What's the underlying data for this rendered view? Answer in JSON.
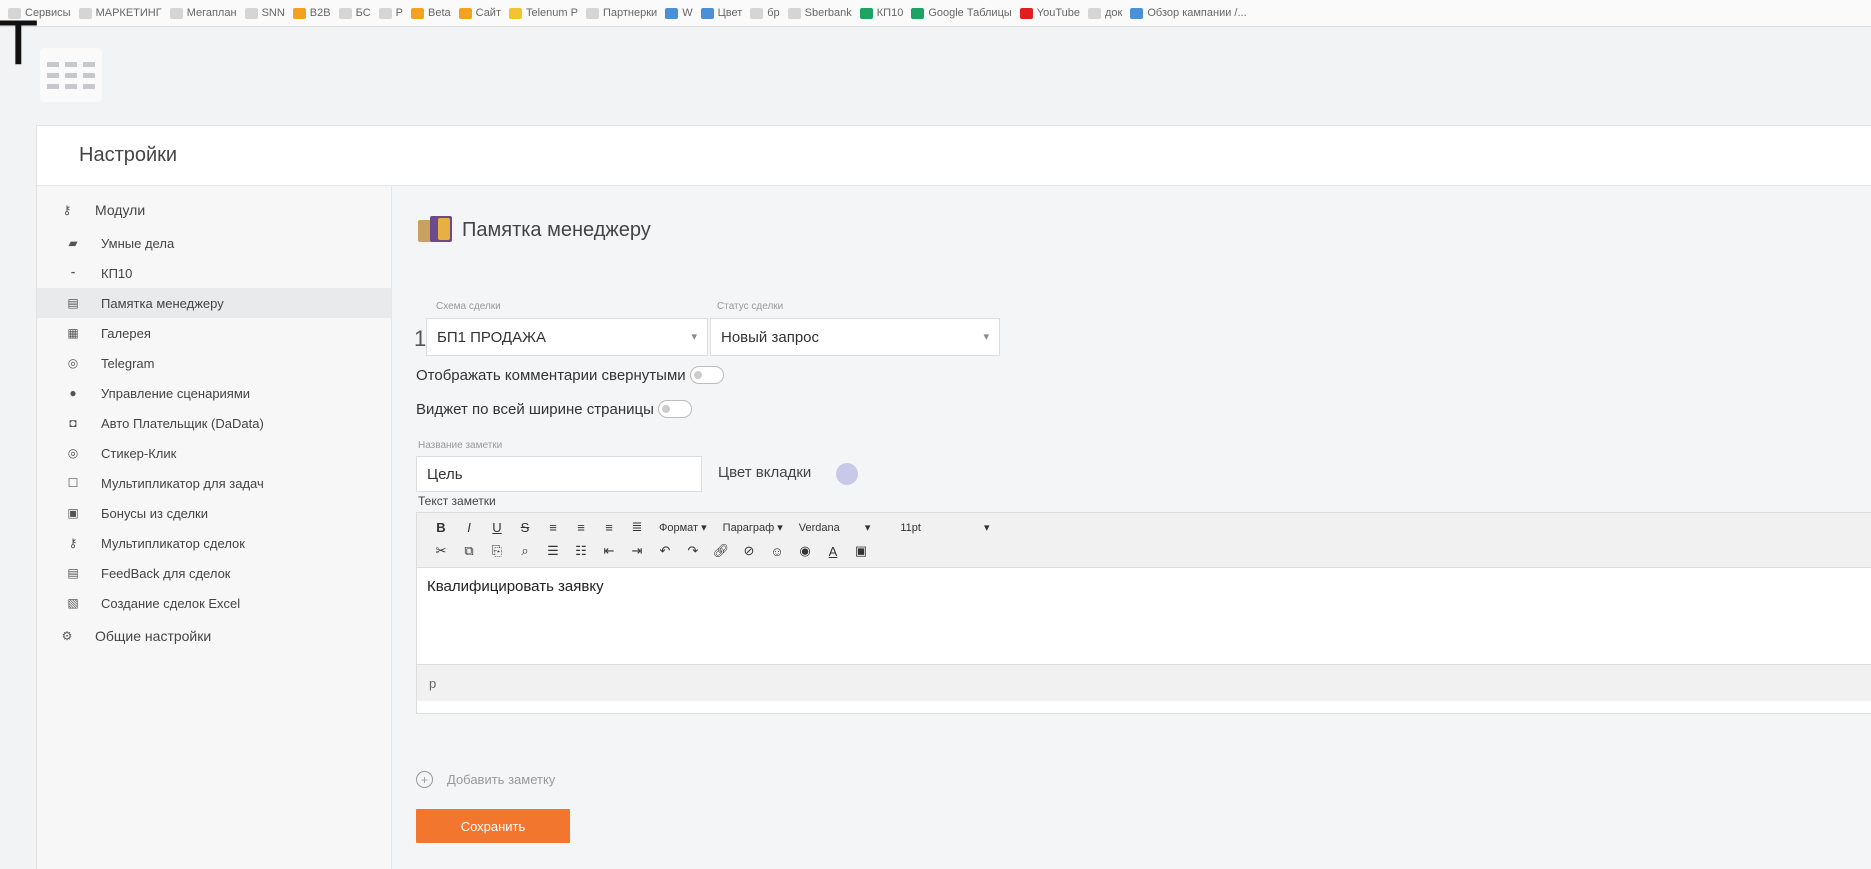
{
  "bookmarks": [
    {
      "label": "Сервисы",
      "icon": "apps-icon",
      "color": "folder"
    },
    {
      "label": "МАРКЕТИНГ",
      "icon": "folder-icon",
      "color": "folder"
    },
    {
      "label": "Мегаплан",
      "icon": "folder-icon",
      "color": "folder"
    },
    {
      "label": "SNN",
      "icon": "folder-icon",
      "color": "folder"
    },
    {
      "label": "B2B",
      "icon": "bookmark-icon",
      "color": "orange"
    },
    {
      "label": "БС",
      "icon": "folder-icon",
      "color": "folder"
    },
    {
      "label": "P",
      "icon": "folder-icon",
      "color": "folder"
    },
    {
      "label": "Beta",
      "icon": "bookmark-icon",
      "color": "orange"
    },
    {
      "label": "Сайт",
      "icon": "bookmark-icon",
      "color": "orange"
    },
    {
      "label": "Telenum P",
      "icon": "bookmark-icon",
      "color": "yellow"
    },
    {
      "label": "Партнерки",
      "icon": "folder-icon",
      "color": "folder"
    },
    {
      "label": "W",
      "icon": "bookmark-icon",
      "color": "blue"
    },
    {
      "label": "Цвет",
      "icon": "bookmark-icon",
      "color": "blue"
    },
    {
      "label": "бр",
      "icon": "folder-icon",
      "color": "folder"
    },
    {
      "label": "Sberbank",
      "icon": "page-icon",
      "color": "folder"
    },
    {
      "label": "КП10",
      "icon": "bookmark-icon",
      "color": "green"
    },
    {
      "label": "Google Таблицы",
      "icon": "sheets-icon",
      "color": "green"
    },
    {
      "label": "YouTube",
      "icon": "youtube-icon",
      "color": "red"
    },
    {
      "label": "док",
      "icon": "page-icon",
      "color": "folder"
    },
    {
      "label": "Обзор кампании /...",
      "icon": "bookmark-icon",
      "color": "blue"
    }
  ],
  "overlay_text": "T",
  "settings": {
    "title": "Настройки"
  },
  "sidebar": {
    "section_modules": "Модули",
    "items": [
      {
        "label": "Умные дела",
        "icon": "smart-tasks-icon"
      },
      {
        "label": "КП10",
        "icon": "kp10-icon"
      },
      {
        "label": "Памятка менеджеру",
        "icon": "memo-icon",
        "active": true
      },
      {
        "label": "Галерея",
        "icon": "gallery-icon"
      },
      {
        "label": "Telegram",
        "icon": "telegram-icon"
      },
      {
        "label": "Управление сценариями",
        "icon": "scenario-icon"
      },
      {
        "label": "Авто Плательщик (DaData)",
        "icon": "payer-icon"
      },
      {
        "label": "Стикер-Клик",
        "icon": "sticker-icon"
      },
      {
        "label": "Мультипликатор для задач",
        "icon": "multiplier-tasks-icon"
      },
      {
        "label": "Бонусы из сделки",
        "icon": "bonus-icon"
      },
      {
        "label": "Мультипликатор сделок",
        "icon": "multiplier-deals-icon"
      },
      {
        "label": "FeedBack для сделок",
        "icon": "feedback-icon"
      },
      {
        "label": "Создание сделок Excel",
        "icon": "excel-icon"
      }
    ],
    "section_general": "Общие настройки"
  },
  "main": {
    "title": "Памятка менеджеру",
    "row_number": "1",
    "pipeline_label": "Схема сделки",
    "pipeline_value": "БП1 ПРОДАЖА",
    "status_label": "Статус сделки",
    "status_value": "Новый запрос",
    "toggle_collapsed_label": "Отображать комментарии свернутыми",
    "toggle_fullwidth_label": "Виджет по всей ширине страницы",
    "note_name_label": "Название заметки",
    "note_name_value": "Цель",
    "tab_color_label": "Цвет вкладки",
    "tab_color": "#c8c8e8",
    "note_text_label": "Текст заметки",
    "editor": {
      "format_label": "Формат",
      "paragraph_label": "Параграф",
      "font_label": "Verdana",
      "size_label": "11pt",
      "content": "Квалифицировать заявку",
      "status_path": "p"
    },
    "add_note_label": "Добавить заметку",
    "save_label": "Сохранить"
  },
  "colors": {
    "accent": "#f2762e",
    "sidebar_active": "#e9eaec"
  }
}
